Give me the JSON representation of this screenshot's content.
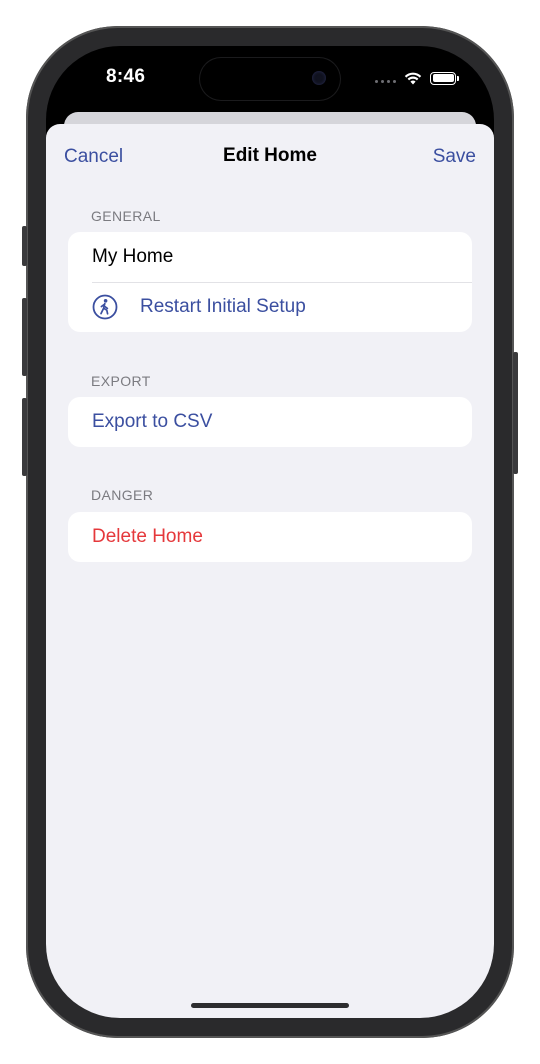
{
  "status_bar": {
    "time": "8:46"
  },
  "nav": {
    "cancel_label": "Cancel",
    "title": "Edit Home",
    "save_label": "Save"
  },
  "sections": {
    "general": {
      "header": "GENERAL",
      "name_value": "My Home",
      "restart_label": "Restart Initial Setup",
      "restart_icon": "figure-walk-circle-icon"
    },
    "export": {
      "header": "EXPORT",
      "export_label": "Export to CSV"
    },
    "danger": {
      "header": "DANGER",
      "delete_label": "Delete Home"
    }
  },
  "colors": {
    "accent": "#3b4fa0",
    "danger": "#e5383b",
    "background": "#f1f1f6"
  }
}
